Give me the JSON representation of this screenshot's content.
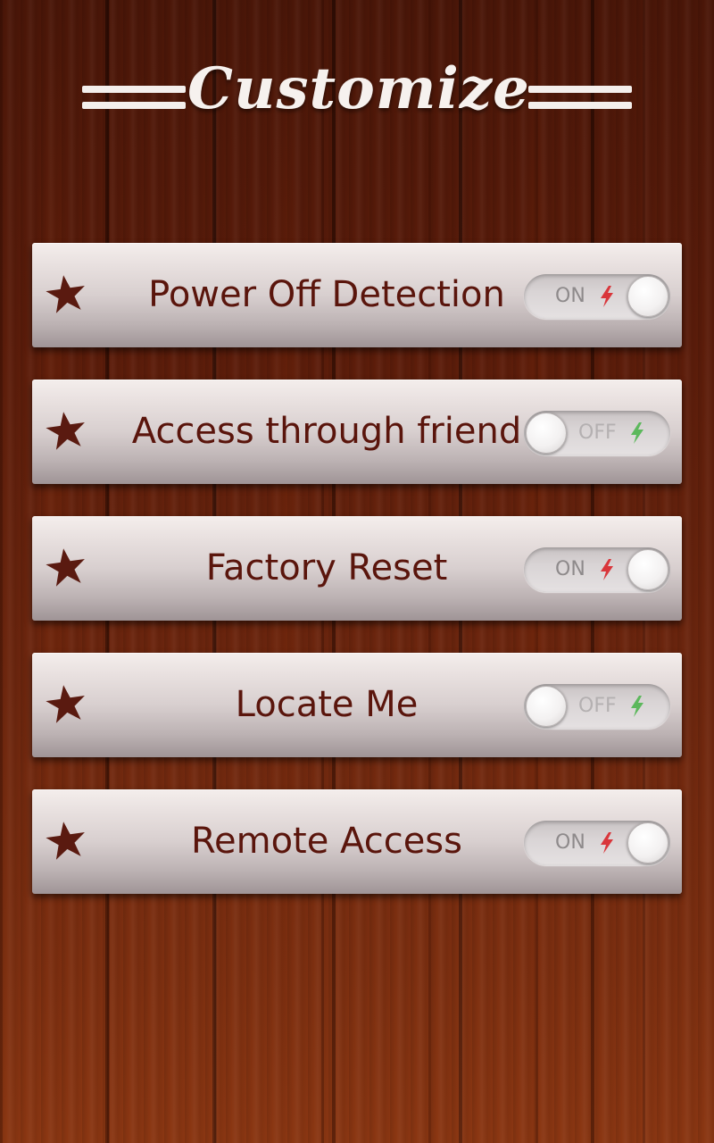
{
  "header": {
    "title": "Customize"
  },
  "settings": [
    {
      "label": "Power Off Detection",
      "state": "ON"
    },
    {
      "label": "Access through friend",
      "state": "OFF"
    },
    {
      "label": "Factory Reset",
      "state": "ON"
    },
    {
      "label": "Locate Me",
      "state": "OFF"
    },
    {
      "label": "Remote Access",
      "state": "ON"
    }
  ],
  "colors": {
    "label_text": "#5a150c",
    "star": "#5a1a10",
    "bolt_on": "#d9363b",
    "bolt_off": "#5cb85c"
  },
  "icons": {
    "row_icon": "star-icon",
    "toggle_icon": "lightning-bolt-icon"
  }
}
